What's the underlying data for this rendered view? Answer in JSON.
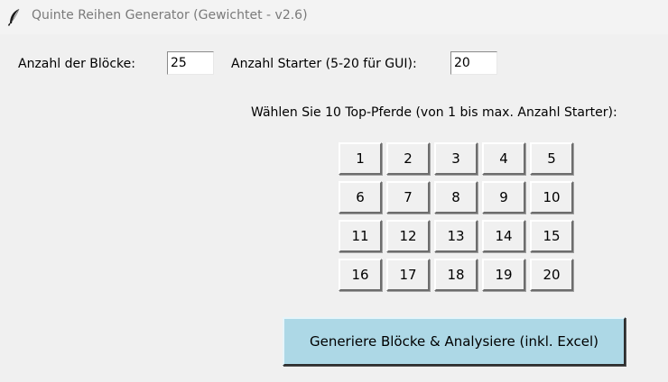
{
  "window": {
    "title": "Quinte Reihen Generator (Gewichtet - v2.6)"
  },
  "form": {
    "blocks_label": "Anzahl der Blöcke:",
    "blocks_value": "25",
    "starters_label": "Anzahl Starter (5-20 für GUI):",
    "starters_value": "20",
    "instruction": "Wählen Sie 10 Top-Pferde (von 1 bis max. Anzahl Starter):"
  },
  "horses": [
    "1",
    "2",
    "3",
    "4",
    "5",
    "6",
    "7",
    "8",
    "9",
    "10",
    "11",
    "12",
    "13",
    "14",
    "15",
    "16",
    "17",
    "18",
    "19",
    "20"
  ],
  "actions": {
    "generate_label": "Generiere Blöcke & Analysiere (inkl. Excel)"
  },
  "colors": {
    "generate_button": "#add8e6",
    "window_background": "#f0f0f0"
  },
  "icons": {
    "app": "feather-icon"
  }
}
